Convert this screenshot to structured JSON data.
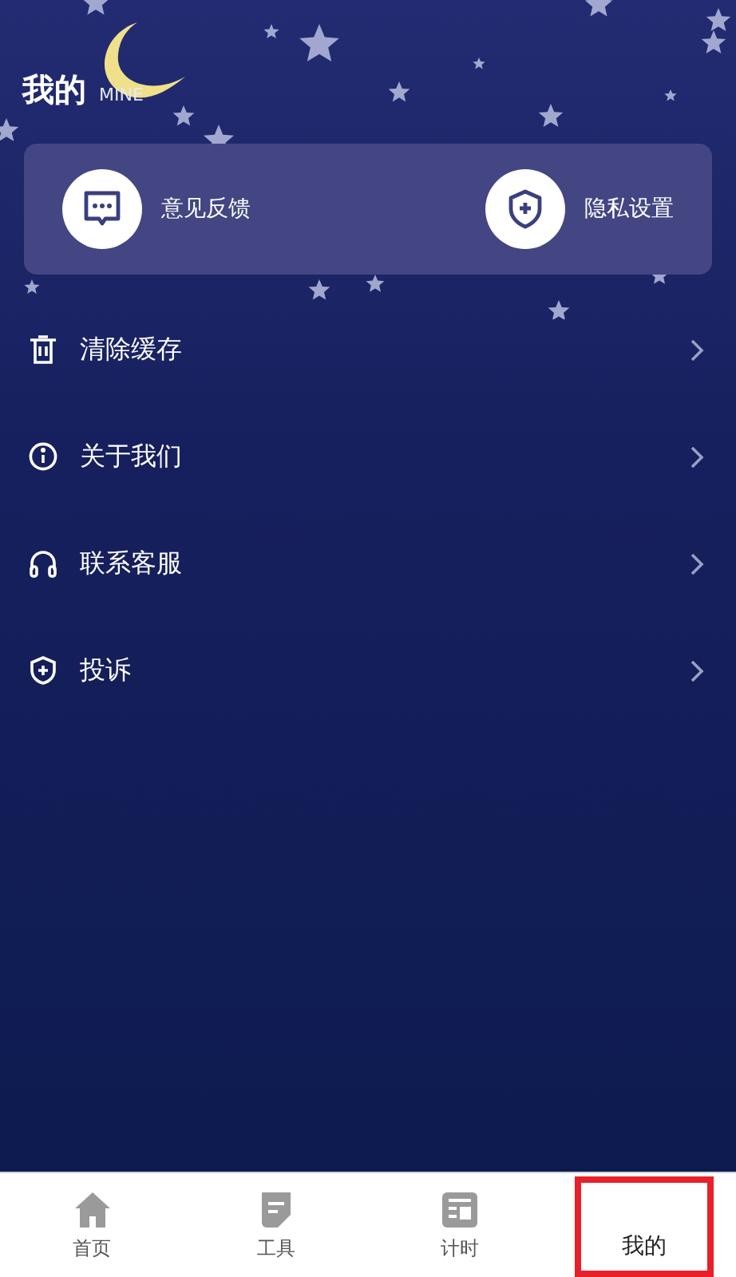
{
  "header": {
    "title": "我的",
    "subtitle": "MINE"
  },
  "quick_actions": [
    {
      "kind": "feedback",
      "label": "意见反馈"
    },
    {
      "kind": "privacy",
      "label": "隐私设置"
    }
  ],
  "menu": [
    {
      "kind": "trash",
      "label": "清除缓存"
    },
    {
      "kind": "info",
      "label": "关于我们"
    },
    {
      "kind": "headset",
      "label": "联系客服"
    },
    {
      "kind": "shield",
      "label": "投诉"
    }
  ],
  "tabs": [
    {
      "kind": "home",
      "label": "首页",
      "selected": false
    },
    {
      "kind": "tools",
      "label": "工具",
      "selected": false
    },
    {
      "kind": "timer",
      "label": "计时",
      "selected": false
    },
    {
      "kind": "mine",
      "label": "我的",
      "selected": true
    }
  ]
}
